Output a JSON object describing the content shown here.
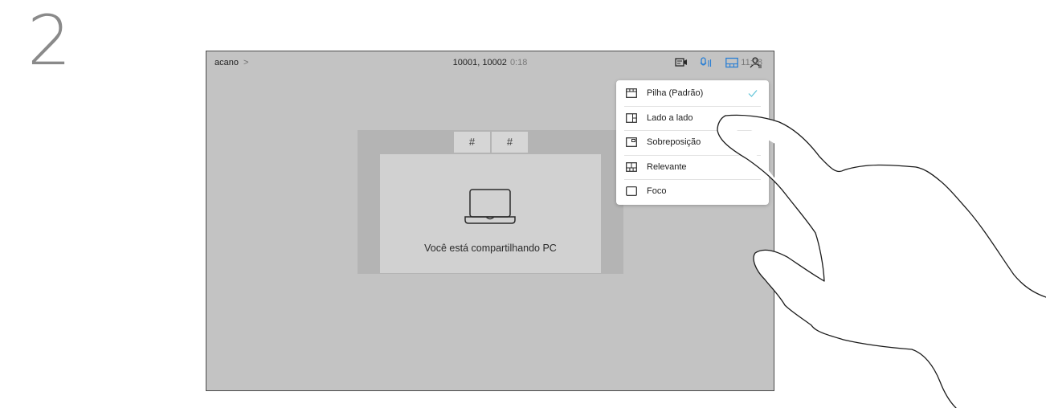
{
  "step_number": "2",
  "topbar": {
    "breadcrumb": "acano",
    "breadcrumb_chevron": ">",
    "call_numbers": "10001, 10002",
    "call_timer": "0:18",
    "icons": [
      "self-view-icon",
      "microphone-icon",
      "layout-icon",
      "participants-icon"
    ],
    "accent_color": "#2a7fd4",
    "clock": "11:28"
  },
  "share": {
    "tiles": [
      "#",
      "#"
    ],
    "message": "Você está compartilhando PC"
  },
  "layout_menu": {
    "items": [
      {
        "label": "Pilha (Padrão)",
        "icon": "stack-layout-icon",
        "selected": true
      },
      {
        "label": "Lado a lado",
        "icon": "side-by-side-layout-icon",
        "selected": false
      },
      {
        "label": "Sobreposição",
        "icon": "overlay-layout-icon",
        "selected": false
      },
      {
        "label": "Relevante",
        "icon": "prominent-layout-icon",
        "selected": false
      },
      {
        "label": "Foco",
        "icon": "focus-layout-icon",
        "selected": false
      }
    ],
    "check_color": "#5fc4d8"
  }
}
